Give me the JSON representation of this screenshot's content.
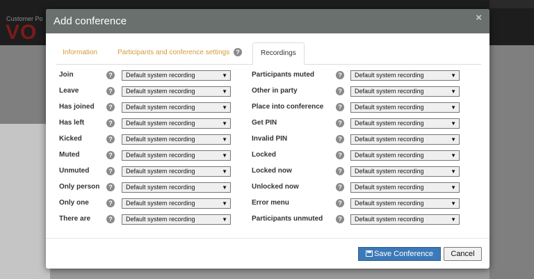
{
  "background_app": {
    "brand_small": "Customer Po",
    "brand_logo": "VO"
  },
  "modal": {
    "title": "Add conference",
    "close_label": "×",
    "tabs": [
      {
        "label": "Information",
        "active": false
      },
      {
        "label": "Participants and conference settings",
        "active": false,
        "help": "?"
      },
      {
        "label": "Recordings",
        "active": true
      }
    ],
    "help_glyph": "?",
    "left_rows": [
      {
        "label": "Join",
        "value": "Default system recording"
      },
      {
        "label": "Leave",
        "value": "Default system recording"
      },
      {
        "label": "Has joined",
        "value": "Default system recording"
      },
      {
        "label": "Has left",
        "value": "Default system recording"
      },
      {
        "label": "Kicked",
        "value": "Default system recording"
      },
      {
        "label": "Muted",
        "value": "Default system recording"
      },
      {
        "label": "Unmuted",
        "value": "Default system recording"
      },
      {
        "label": "Only person",
        "value": "Default system recording"
      },
      {
        "label": "Only one",
        "value": "Default system recording"
      },
      {
        "label": "There are",
        "value": "Default system recording"
      }
    ],
    "right_rows": [
      {
        "label": "Participants muted",
        "value": "Default system recording"
      },
      {
        "label": "Other in party",
        "value": "Default system recording"
      },
      {
        "label": "Place into conference",
        "value": "Default system recording"
      },
      {
        "label": "Get PIN",
        "value": "Default system recording"
      },
      {
        "label": "Invalid PIN",
        "value": "Default system recording"
      },
      {
        "label": "Locked",
        "value": "Default system recording"
      },
      {
        "label": "Locked now",
        "value": "Default system recording"
      },
      {
        "label": "Unlocked now",
        "value": "Default system recording"
      },
      {
        "label": "Error menu",
        "value": "Default system recording"
      },
      {
        "label": "Participants unmuted",
        "value": "Default system recording"
      }
    ],
    "dropdown_arrow": "▼",
    "save_label": "Save Conference",
    "save_icon": "save-icon",
    "cancel_label": "Cancel"
  },
  "colors": {
    "header_bg": "#69706e",
    "tab_link": "#d29a3b",
    "primary_button": "#3b79b8"
  }
}
